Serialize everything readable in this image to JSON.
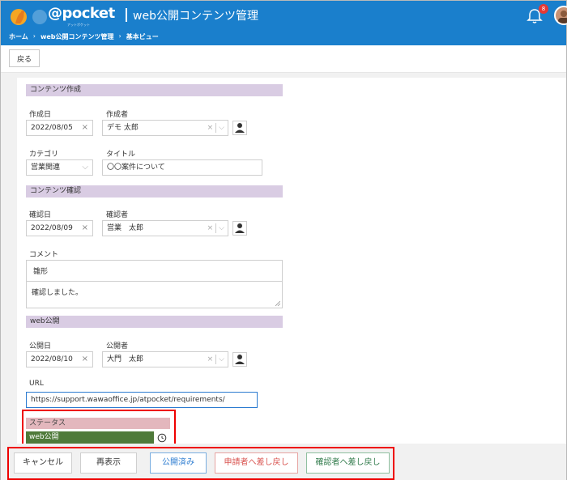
{
  "header": {
    "logo_text": "@pocket",
    "logo_sub": "アットポケット",
    "title": "web公開コンテンツ管理",
    "notification_count": "8",
    "breadcrumb": [
      "ホーム",
      "web公開コンテンツ管理",
      "基本ビュー"
    ],
    "accent_color": "#1a7fcc"
  },
  "toolbar": {
    "back_label": "戻る"
  },
  "content_creation": {
    "section_title": "コンテンツ作成",
    "created_date_label": "作成日",
    "created_date_value": "2022/08/05",
    "creator_label": "作成者",
    "creator_value": "デモ 太郎",
    "category_label": "カテゴリ",
    "category_value": "営業関連",
    "title_label": "タイトル",
    "title_value": "〇〇案件について"
  },
  "content_review": {
    "section_title": "コンテンツ確認",
    "review_date_label": "確認日",
    "review_date_value": "2022/08/09",
    "reviewer_label": "確認者",
    "reviewer_value": "営業　太郎",
    "comment_label": "コメント",
    "comment_author": "雛形",
    "comment_text": "確認しました。"
  },
  "web_publish": {
    "section_title": "web公開",
    "publish_date_label": "公開日",
    "publish_date_value": "2022/08/10",
    "publisher_label": "公開者",
    "publisher_value": "大門　太郎",
    "url_label": "URL",
    "url_value": "https://support.wawaoffice.jp/atpocket/requirements/"
  },
  "status": {
    "label": "ステータス",
    "value": "web公開",
    "value_color": "#4f7a3a"
  },
  "actions": {
    "cancel": "キャンセル",
    "redisplay": "再表示",
    "published": "公開済み",
    "return_to_applicant": "申請者へ差し戻し",
    "return_to_reviewer": "確認者へ差し戻し"
  }
}
